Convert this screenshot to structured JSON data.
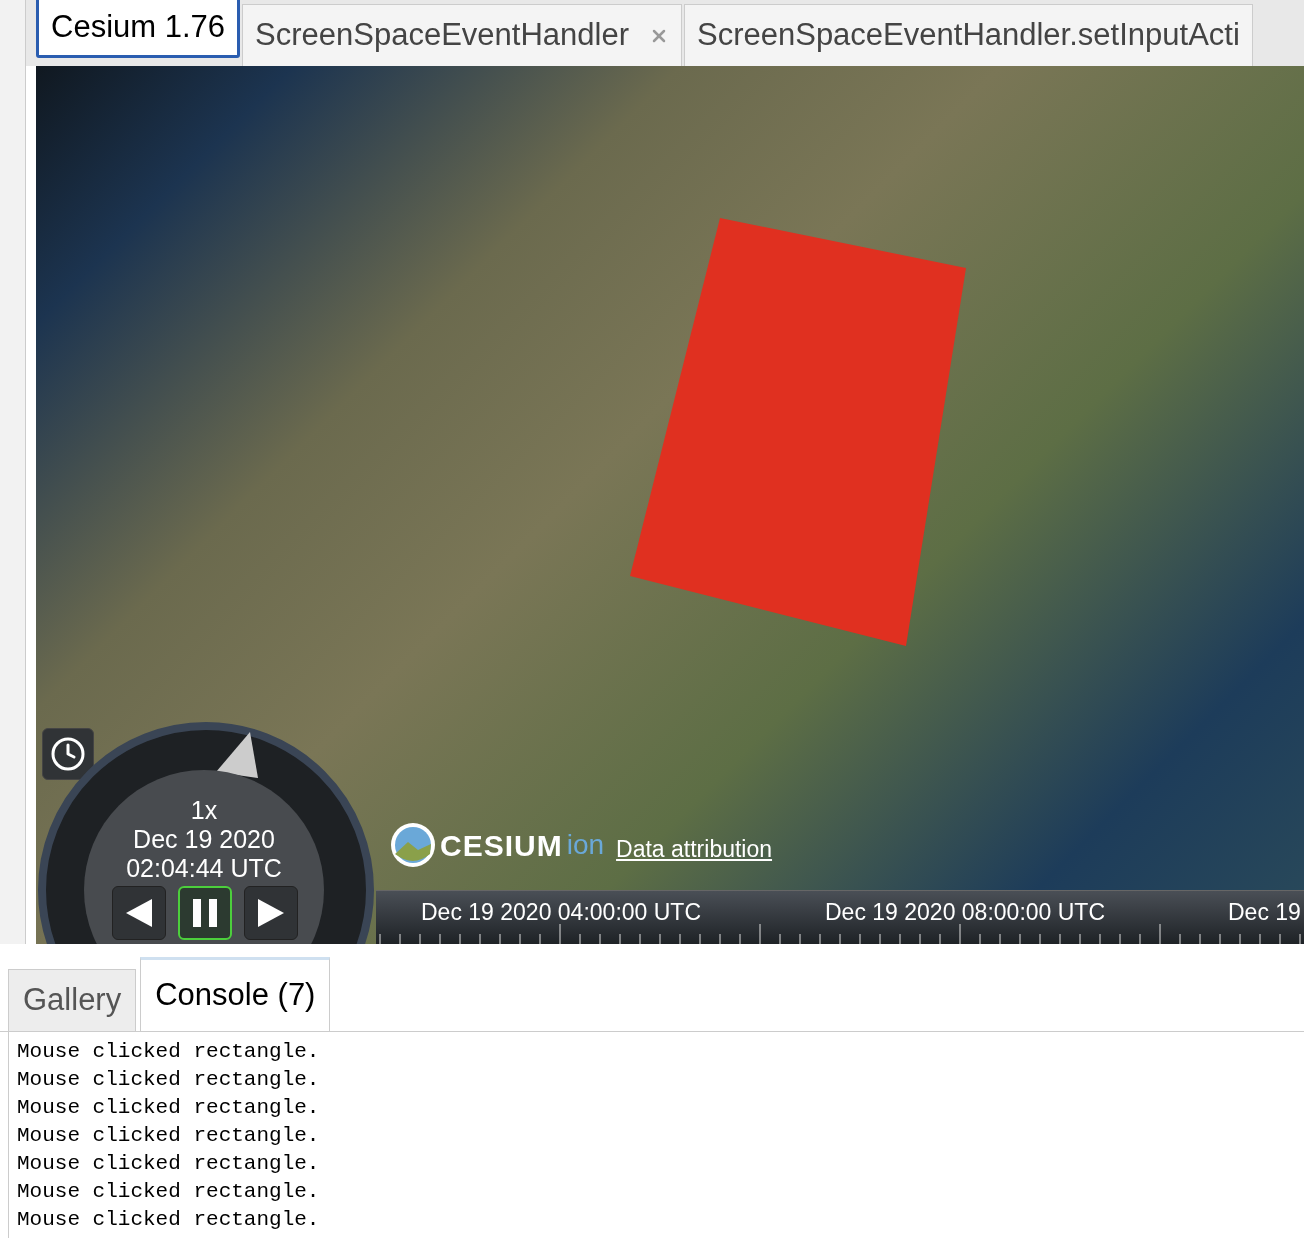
{
  "doc_tabs": [
    {
      "label": "Cesium 1.76",
      "selected": true,
      "closable": false
    },
    {
      "label": "ScreenSpaceEventHandler",
      "selected": false,
      "closable": true
    },
    {
      "label": "ScreenSpaceEventHandler.setInputActi",
      "selected": false,
      "closable": false
    }
  ],
  "viewer": {
    "logo": {
      "brand": "CESIUM",
      "suffix": "ion"
    },
    "attribution_link": "Data attribution",
    "animation": {
      "speed": "1x",
      "date": "Dec 19 2020",
      "time": "02:04:44 UTC",
      "buttons": [
        {
          "kind": "reverse",
          "selected": false
        },
        {
          "kind": "pause",
          "selected": true
        },
        {
          "kind": "play",
          "selected": false
        }
      ]
    },
    "timeline": {
      "labels": [
        "Dec 19 2020 04:00:00 UTC",
        "Dec 19 2020 08:00:00 UTC",
        "Dec 19"
      ]
    }
  },
  "bottom_tabs": [
    {
      "label": "Gallery",
      "selected": false
    },
    {
      "label": "Console (7)",
      "selected": true
    }
  ],
  "console": {
    "lines": [
      "Mouse clicked rectangle.",
      "Mouse clicked rectangle.",
      "Mouse clicked rectangle.",
      "Mouse clicked rectangle.",
      "Mouse clicked rectangle.",
      "Mouse clicked rectangle.",
      "Mouse clicked rectangle."
    ]
  }
}
